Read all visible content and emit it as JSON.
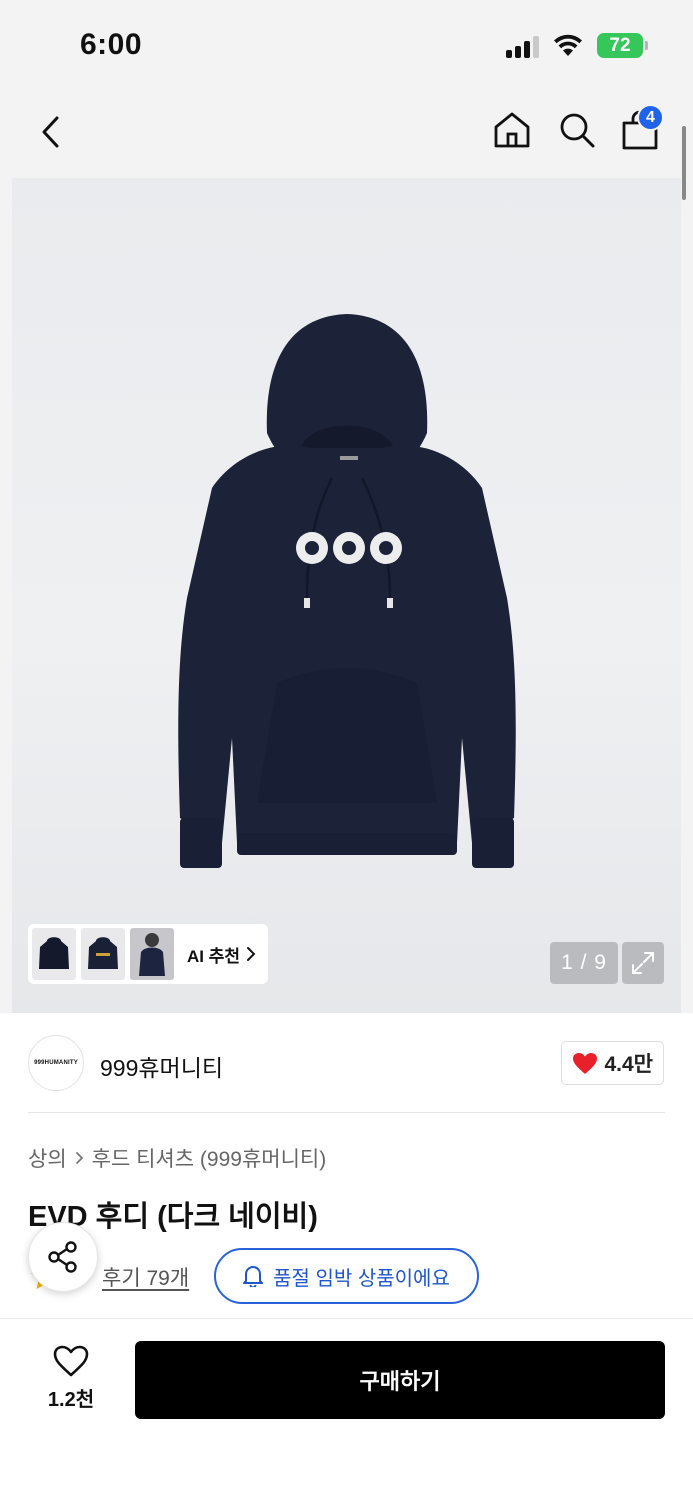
{
  "status_bar": {
    "time": "6:00",
    "battery": "72"
  },
  "header": {
    "cart_count": "4"
  },
  "gallery": {
    "ai_label": "AI 추천",
    "page_counter": "1 / 9",
    "logo_text": "999"
  },
  "brand": {
    "logo_text": "999HUMANITY",
    "name": "999휴머니티",
    "like_count": "4.4만"
  },
  "breadcrumb": {
    "category": "상의",
    "subcategory": "후드 티셔츠 (999휴머니티)"
  },
  "product": {
    "title": "EVD 후디 (다크 네이비)"
  },
  "reviews": {
    "label": "후기 79개"
  },
  "restock": {
    "label": "품절 임박 상품이에요"
  },
  "bottom_bar": {
    "wish_count": "1.2천",
    "buy_label": "구매하기"
  },
  "colors": {
    "accent_blue": "#2a62d9",
    "heart_red": "#e8202a",
    "badge_blue": "#1f63e8",
    "battery_green": "#35c759",
    "hoodie_navy": "#1c2238"
  }
}
